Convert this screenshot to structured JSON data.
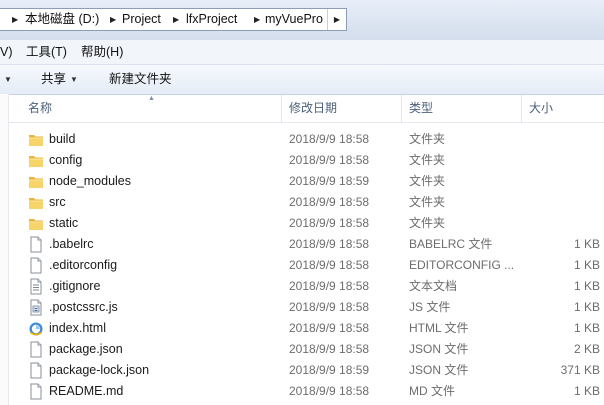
{
  "breadcrumb": {
    "items": [
      "本地磁盘 (D:)",
      "Project",
      "lfxProject",
      "myVuePro"
    ]
  },
  "menubar": {
    "view_partial": "V)",
    "tools": "工具(T)",
    "help": "帮助(H)"
  },
  "toolbar": {
    "share": "共享",
    "new_folder": "新建文件夹"
  },
  "columns": {
    "name": "名称",
    "date": "修改日期",
    "type": "类型",
    "size": "大小"
  },
  "files": [
    {
      "name": "build",
      "date": "2018/9/9 18:58",
      "type": "文件夹",
      "size": "",
      "icon": "folder-icon"
    },
    {
      "name": "config",
      "date": "2018/9/9 18:58",
      "type": "文件夹",
      "size": "",
      "icon": "folder-icon"
    },
    {
      "name": "node_modules",
      "date": "2018/9/9 18:59",
      "type": "文件夹",
      "size": "",
      "icon": "folder-icon"
    },
    {
      "name": "src",
      "date": "2018/9/9 18:58",
      "type": "文件夹",
      "size": "",
      "icon": "folder-icon"
    },
    {
      "name": "static",
      "date": "2018/9/9 18:58",
      "type": "文件夹",
      "size": "",
      "icon": "folder-icon"
    },
    {
      "name": ".babelrc",
      "date": "2018/9/9 18:58",
      "type": "BABELRC 文件",
      "size": "1 KB",
      "icon": "file-icon"
    },
    {
      "name": ".editorconfig",
      "date": "2018/9/9 18:58",
      "type": "EDITORCONFIG ...",
      "size": "1 KB",
      "icon": "file-icon"
    },
    {
      "name": ".gitignore",
      "date": "2018/9/9 18:58",
      "type": "文本文档",
      "size": "1 KB",
      "icon": "text-file-icon"
    },
    {
      "name": ".postcssrc.js",
      "date": "2018/9/9 18:58",
      "type": "JS 文件",
      "size": "1 KB",
      "icon": "script-file-icon"
    },
    {
      "name": "index.html",
      "date": "2018/9/9 18:58",
      "type": "HTML 文件",
      "size": "1 KB",
      "icon": "html-file-icon"
    },
    {
      "name": "package.json",
      "date": "2018/9/9 18:58",
      "type": "JSON 文件",
      "size": "2 KB",
      "icon": "file-icon"
    },
    {
      "name": "package-lock.json",
      "date": "2018/9/9 18:59",
      "type": "JSON 文件",
      "size": "371 KB",
      "icon": "file-icon"
    },
    {
      "name": "README.md",
      "date": "2018/9/9 18:58",
      "type": "MD 文件",
      "size": "1 KB",
      "icon": "file-icon"
    }
  ],
  "colors": {
    "folder": "#f2c94c",
    "header_text": "#4c607a",
    "meta_text": "#6d6d6d"
  }
}
